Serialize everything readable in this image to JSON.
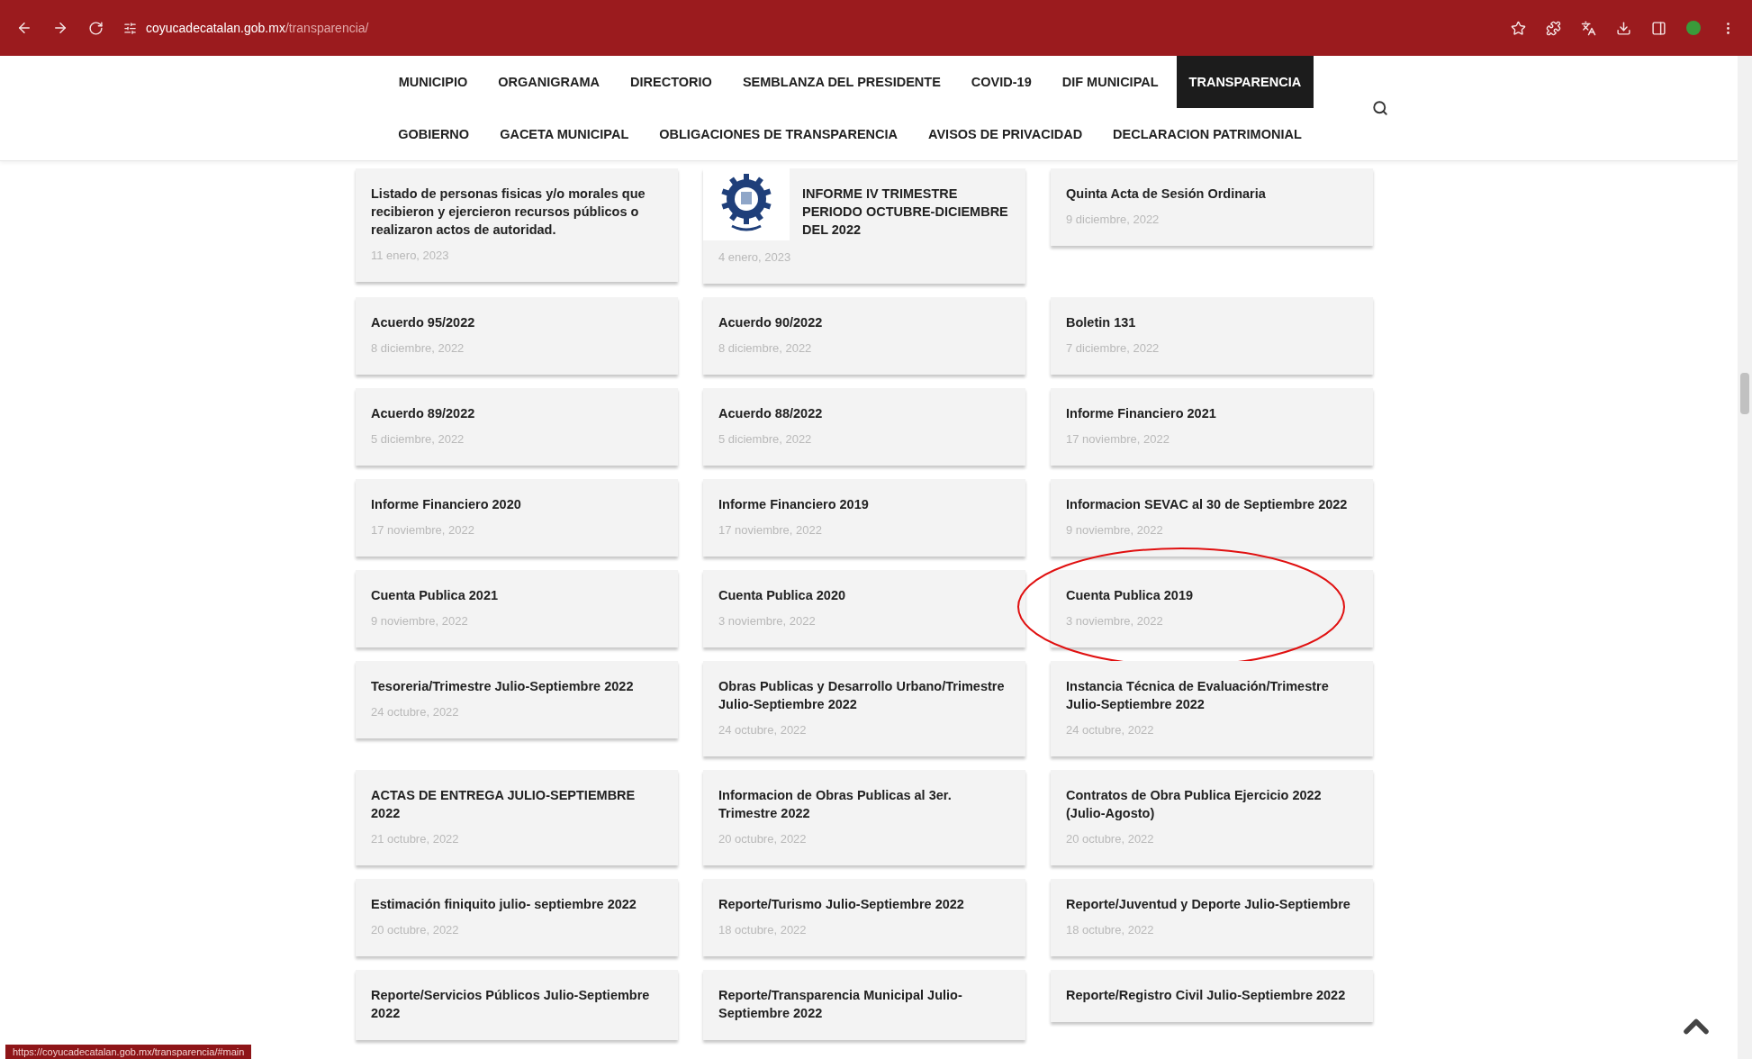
{
  "browser": {
    "url_host": "coyucadecatalan.gob.mx",
    "url_path": "/transparencia/"
  },
  "nav": {
    "top_row": [
      {
        "label": "MUNICIPIO",
        "selected": false
      },
      {
        "label": "ORGANIGRAMA",
        "selected": false
      },
      {
        "label": "DIRECTORIO",
        "selected": false
      },
      {
        "label": "SEMBLANZA DEL PRESIDENTE",
        "selected": false
      },
      {
        "label": "COVID-19",
        "selected": false
      },
      {
        "label": "DIF MUNICIPAL",
        "selected": false
      },
      {
        "label": "TRANSPARENCIA",
        "selected": true
      }
    ],
    "bottom_row": [
      {
        "label": "GOBIERNO",
        "selected": false
      },
      {
        "label": "GACETA MUNICIPAL",
        "selected": false
      },
      {
        "label": "OBLIGACIONES DE TRANSPARENCIA",
        "selected": false
      },
      {
        "label": "AVISOS DE PRIVACIDAD",
        "selected": false
      },
      {
        "label": "DECLARACION PATRIMONIAL",
        "selected": false
      }
    ]
  },
  "posts": [
    {
      "title": "Listado de personas fisicas y/o morales que recibieron y ejercieron recursos públicos o realizaron actos de autoridad.",
      "date": "11 enero, 2023",
      "has_logo": false,
      "highlighted": false
    },
    {
      "title": "INFORME IV TRIMESTRE PERIODO OCTUBRE-DICIEMBRE DEL 2022",
      "date": "4 enero, 2023",
      "has_logo": true,
      "highlighted": false
    },
    {
      "title": "Quinta Acta de Sesión Ordinaria",
      "date": "9 diciembre, 2022",
      "has_logo": false,
      "highlighted": false
    },
    {
      "title": "Acuerdo 95/2022",
      "date": "8 diciembre, 2022",
      "has_logo": false,
      "highlighted": false
    },
    {
      "title": "Acuerdo 90/2022",
      "date": "8 diciembre, 2022",
      "has_logo": false,
      "highlighted": false
    },
    {
      "title": "Boletin 131",
      "date": "7 diciembre, 2022",
      "has_logo": false,
      "highlighted": false
    },
    {
      "title": "Acuerdo 89/2022",
      "date": "5 diciembre, 2022",
      "has_logo": false,
      "highlighted": false
    },
    {
      "title": "Acuerdo 88/2022",
      "date": "5 diciembre, 2022",
      "has_logo": false,
      "highlighted": false
    },
    {
      "title": "Informe Financiero 2021",
      "date": "17 noviembre, 2022",
      "has_logo": false,
      "highlighted": false
    },
    {
      "title": "Informe Financiero 2020",
      "date": "17 noviembre, 2022",
      "has_logo": false,
      "highlighted": false
    },
    {
      "title": "Informe Financiero 2019",
      "date": "17 noviembre, 2022",
      "has_logo": false,
      "highlighted": false
    },
    {
      "title": "Informacion SEVAC al 30 de Septiembre 2022",
      "date": "9 noviembre, 2022",
      "has_logo": false,
      "highlighted": false
    },
    {
      "title": "Cuenta Publica 2021",
      "date": "9 noviembre, 2022",
      "has_logo": false,
      "highlighted": false
    },
    {
      "title": "Cuenta Publica 2020",
      "date": "3 noviembre, 2022",
      "has_logo": false,
      "highlighted": false
    },
    {
      "title": "Cuenta Publica 2019",
      "date": "3 noviembre, 2022",
      "has_logo": false,
      "highlighted": true
    },
    {
      "title": "Tesoreria/Trimestre Julio-Septiembre 2022",
      "date": "24 octubre, 2022",
      "has_logo": false,
      "highlighted": false
    },
    {
      "title": "Obras Publicas y Desarrollo Urbano/Trimestre Julio-Septiembre 2022",
      "date": "24 octubre, 2022",
      "has_logo": false,
      "highlighted": false
    },
    {
      "title": "Instancia Técnica de Evaluación/Trimestre Julio-Septiembre 2022",
      "date": "24 octubre, 2022",
      "has_logo": false,
      "highlighted": false
    },
    {
      "title": "ACTAS DE ENTREGA JULIO-SEPTIEMBRE 2022",
      "date": "21 octubre, 2022",
      "has_logo": false,
      "highlighted": false
    },
    {
      "title": "Informacion de Obras Publicas al 3er. Trimestre 2022",
      "date": "20 octubre, 2022",
      "has_logo": false,
      "highlighted": false
    },
    {
      "title": "Contratos de Obra Publica Ejercicio 2022 (Julio-Agosto)",
      "date": "20 octubre, 2022",
      "has_logo": false,
      "highlighted": false
    },
    {
      "title": "Estimación finiquito julio- septiembre 2022",
      "date": "20 octubre, 2022",
      "has_logo": false,
      "highlighted": false
    },
    {
      "title": "Reporte/Turismo Julio-Septiembre 2022",
      "date": "18 octubre, 2022",
      "has_logo": false,
      "highlighted": false
    },
    {
      "title": "Reporte/Juventud y Deporte Julio-Septiembre",
      "date": "18 octubre, 2022",
      "has_logo": false,
      "highlighted": false
    },
    {
      "title": "Reporte/Servicios Públicos Julio-Septiembre 2022",
      "has_logo": false,
      "highlighted": false
    },
    {
      "title": "Reporte/Transparencia Municipal Julio-Septiembre 2022",
      "has_logo": false,
      "highlighted": false
    },
    {
      "title": "Reporte/Registro Civil Julio-Septiembre 2022",
      "has_logo": false,
      "highlighted": false
    }
  ],
  "status_link": "https://coyucadecatalan.gob.mx/transparencia/#main"
}
